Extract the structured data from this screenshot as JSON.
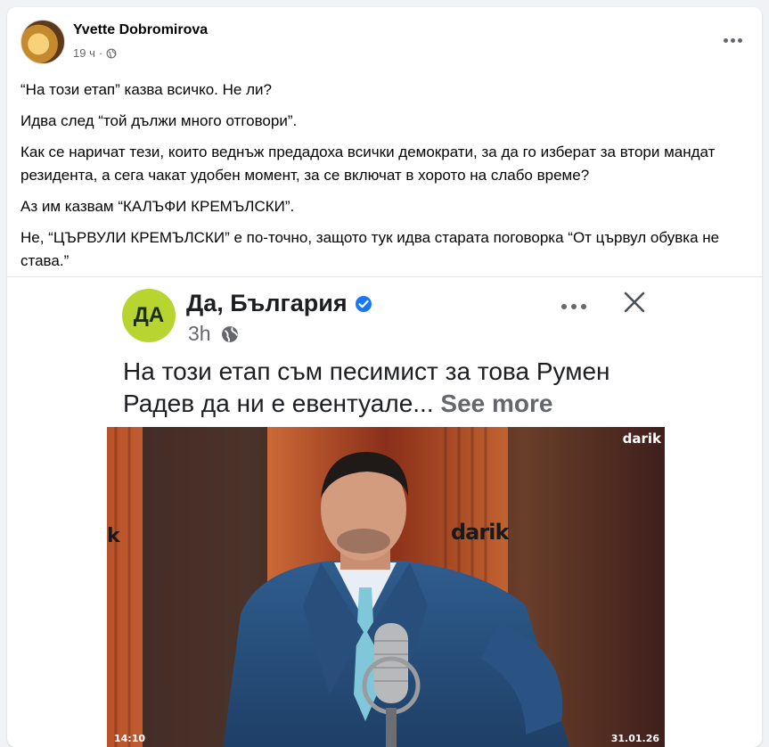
{
  "post": {
    "author": "Yvette Dobromirova",
    "time": "19 ч",
    "separator": "·",
    "privacy_icon": "globe-icon",
    "more_icon": "more-horizontal-icon",
    "paragraphs": [
      "“На този етап” казва всичко. Не ли?",
      "Идва след “той дължи много отговори”.",
      "Как се наричат тези, които веднъж предадоха всички демократи, за да го изберат за втори мандат резидента, а сега чакат удобен момент, за се включат в хорото на слабо време?",
      "Аз им казвам “КАЛЪФИ КРЕМЪЛСКИ”.",
      "Не, “ЦЪРВУЛИ КРЕМЪЛСКИ” е по-точно, защото тук идва старата поговорка “От цървул обувка не става.”"
    ]
  },
  "embedded": {
    "logo_text": "ДА",
    "page_name": "Да, България",
    "verified_icon": "verified-badge-icon",
    "time": "3h",
    "privacy_icon": "globe-icon",
    "more_icon": "more-horizontal-icon",
    "close_icon": "close-icon",
    "caption": "На този етап съм песимист за това Румен Радев да ни е евентуале...",
    "see_more": "See more",
    "video": {
      "brand_top": "darik",
      "brand_mid": "darik",
      "brand_left": "k",
      "timestamp_left": "14:10",
      "timestamp_right": "31.01.26"
    }
  },
  "colors": {
    "page_bg": "#f0f2f5",
    "card_bg": "#ffffff",
    "secondary_text": "#65676b",
    "verified": "#1877f2",
    "da_logo": "#b8d430"
  }
}
